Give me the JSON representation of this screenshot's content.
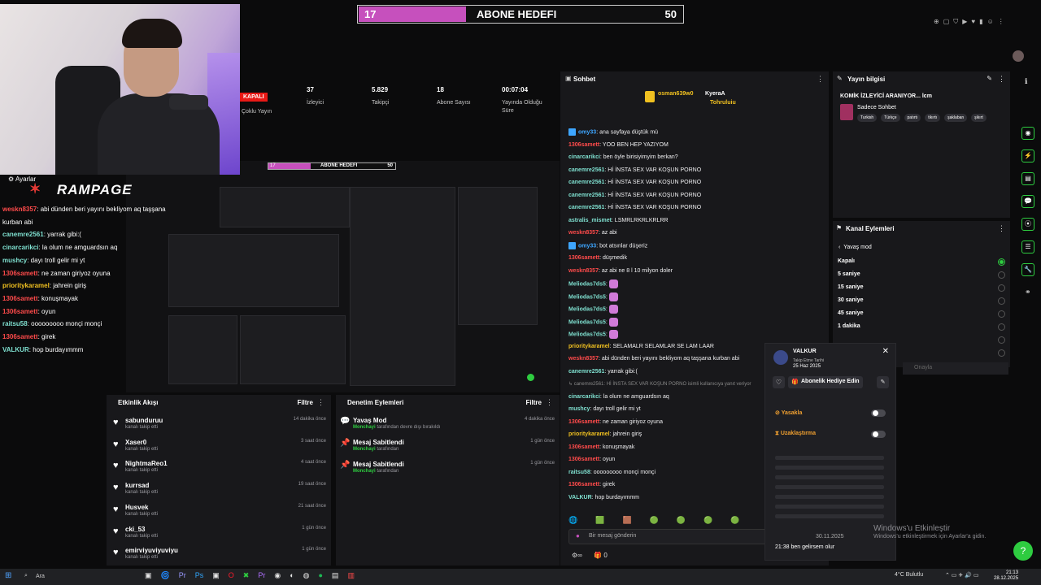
{
  "goal": {
    "current": "17",
    "title": "ABONE HEDEFI",
    "target": "50",
    "progress_fraction": 0.34
  },
  "overlay": {
    "settings_label": "Ayarlar",
    "logo": "RAMPAGE",
    "lines": [
      {
        "user": "weskn8357",
        "text": ": abi dünden beri yayını bekliyom aq taşşana",
        "color": "#ff4b4b"
      },
      {
        "user": "",
        "text": "kurban abi",
        "color": "#ffffff"
      },
      {
        "user": "canemre2561",
        "text": ": yarrak gibi:(",
        "color": "#7fe0d0"
      },
      {
        "user": "cinarcarikci",
        "text": ": la olum ne amguardsın aq",
        "color": "#7fe0d0"
      },
      {
        "user": "mushcy",
        "text": ": dayı troll gelir mi yt",
        "color": "#7fe0d0"
      },
      {
        "user": "1306samett",
        "text": ": ne zaman giriyoz oyuna",
        "color": "#ff4b4b"
      },
      {
        "user": "prioritykaramel",
        "text": ": jahrein giriş",
        "color": "#f0c020"
      },
      {
        "user": "1306samett",
        "text": ": konuşmayak",
        "color": "#ff4b4b"
      },
      {
        "user": "1306samett",
        "text": ": oyun",
        "color": "#ff4b4b"
      },
      {
        "user": "raitsu58",
        "text": ": ooooooooo monçi monçi",
        "color": "#7fe0d0"
      },
      {
        "user": "1306samett",
        "text": ": girek",
        "color": "#ff4b4b"
      },
      {
        "user": "VALKUR",
        "text": ": hop burdayımmm",
        "color": "#7fe0d0"
      }
    ]
  },
  "stats": {
    "live_badge": "KAPALI",
    "multi_label": "Çoklu Yayın",
    "items": [
      {
        "value": "37",
        "label": "İzleyici"
      },
      {
        "value": "5.829",
        "label": "Takipçi"
      },
      {
        "value": "18",
        "label": "Abone Sayısı"
      },
      {
        "value": "00:07:04",
        "label": "Yayında Olduğu Süre"
      }
    ]
  },
  "preview": {
    "goal_current": "17",
    "goal_title": "ABONE HEDEFI",
    "goal_target": "50"
  },
  "feed": {
    "title": "Etkinlik Akışı",
    "filter": "Filtre",
    "items": [
      {
        "name": "sabunduruu",
        "sub": "kanalı takip etti",
        "time": "14 dakika önce"
      },
      {
        "name": "Xaser0",
        "sub": "kanalı takip etti",
        "time": "3 saat önce"
      },
      {
        "name": "NightmaReo1",
        "sub": "kanalı takip etti",
        "time": "4 saat önce"
      },
      {
        "name": "kurrsad",
        "sub": "kanalı takip etti",
        "time": "19 saat önce"
      },
      {
        "name": "Husvek",
        "sub": "kanalı takip etti",
        "time": "21 saat önce"
      },
      {
        "name": "cki_53",
        "sub": "kanalı takip etti",
        "time": "1 gün önce"
      },
      {
        "name": "emirviyuviyuviyu",
        "sub": "kanalı takip etti",
        "time": "1 gün önce"
      }
    ]
  },
  "mod": {
    "title": "Denetim Eylemleri",
    "filter": "Filtre",
    "items": [
      {
        "icon": "💬",
        "name": "Yavaş Mod",
        "actor": "Monchayi",
        "sub": " tarafından devre dışı bırakıldı",
        "time": "4 dakika önce"
      },
      {
        "icon": "📌",
        "name": "Mesaj Sabitlendi",
        "actor": "Monchayi",
        "sub": " tarafından",
        "time": "1 gün önce"
      },
      {
        "icon": "📌",
        "name": "Mesaj Sabitlendi",
        "actor": "Monchayi",
        "sub": " tarafından",
        "time": "1 gün önce"
      }
    ]
  },
  "chat": {
    "title": "Sohbet",
    "top": [
      {
        "name": "osman639w0",
        "color": "#f0c020"
      },
      {
        "name": "KyeraA",
        "color": "#ffffff"
      },
      {
        "name": "Tohruluiu",
        "color": "#f0c020"
      }
    ],
    "messages": [
      {
        "user": "omy33",
        "text": ": ana sayfaya düştük mü",
        "color": "#3ea6ff",
        "badge": true
      },
      {
        "user": "1306samett",
        "text": ": YOO BEN HEP YAZIYOM",
        "color": "#ff4b4b"
      },
      {
        "user": "cinarcarikci",
        "text": ": ben öyle birisiyimyim berkan?",
        "color": "#7fe0d0"
      },
      {
        "user": "canemre2561",
        "text": ": Hİ İNSTA SEX VAR KOŞUN PORNO",
        "color": "#7fe0d0"
      },
      {
        "user": "canemre2561",
        "text": ": Hİ İNSTA SEX VAR KOŞUN PORNO",
        "color": "#7fe0d0"
      },
      {
        "user": "canemre2561",
        "text": ": Hİ İNSTA SEX VAR KOŞUN PORNO",
        "color": "#7fe0d0"
      },
      {
        "user": "canemre2561",
        "text": ": Hİ İNSTA SEX VAR KOŞUN PORNO",
        "color": "#7fe0d0"
      },
      {
        "user": "astralis_mismet",
        "text": ": LSMRLRKRLKRLRR",
        "color": "#7fe0d0"
      },
      {
        "user": "weskn8357",
        "text": ": az abi",
        "color": "#ff4b4b"
      },
      {
        "user": "omy33",
        "text": ": bot atsınlar düşeriz",
        "color": "#3ea6ff",
        "badge": true
      },
      {
        "user": "1306samett",
        "text": ": düşmedik",
        "color": "#ff4b4b"
      },
      {
        "user": "weskn8357",
        "text": ": az abi ne 8 l 10 milyon doler",
        "color": "#ff4b4b"
      },
      {
        "user": "Meliodas7ds5",
        "text": ":",
        "color": "#7fe0d0",
        "emote": true
      },
      {
        "user": "Meliodas7ds5",
        "text": ":",
        "color": "#7fe0d0",
        "emote": true
      },
      {
        "user": "Meliodas7ds5",
        "text": ":",
        "color": "#7fe0d0",
        "emote": true
      },
      {
        "user": "Meliodas7ds5",
        "text": ":",
        "color": "#7fe0d0",
        "emote": true
      },
      {
        "user": "Meliodas7ds5",
        "text": ":",
        "color": "#7fe0d0",
        "emote": true
      },
      {
        "user": "prioritykaramel",
        "text": ": SELAMALR SELAMLAR SE LAM LAAR",
        "color": "#f0c020"
      },
      {
        "user": "weskn8357",
        "text": ": abi dünden beri yayını bekliyom aq taşşana kurban abi",
        "color": "#ff4b4b"
      },
      {
        "user": "canemre2561",
        "text": ": yarrak gibi:(",
        "color": "#7fe0d0"
      },
      {
        "user": "",
        "text": "↳ canemre2561: Hİ İNSTA SEX VAR KOŞUN PORNO isimli kullanıcıya yanıt veriyor",
        "color": "#888888"
      },
      {
        "user": "cinarcarikci",
        "text": ": la olum ne amguardsın aq",
        "color": "#7fe0d0"
      },
      {
        "user": "mushcy",
        "text": ": dayı troll gelir mi yt",
        "color": "#7fe0d0"
      },
      {
        "user": "1306samett",
        "text": ": ne zaman giriyoz oyuna",
        "color": "#ff4b4b"
      },
      {
        "user": "prioritykaramel",
        "text": ": jahrein giriş",
        "color": "#f0c020"
      },
      {
        "user": "1306samett",
        "text": ": konuşmayak",
        "color": "#ff4b4b"
      },
      {
        "user": "1306samett",
        "text": ": oyun",
        "color": "#ff4b4b"
      },
      {
        "user": "raitsu58",
        "text": ": ooooooooo monçi monçi",
        "color": "#7fe0d0"
      },
      {
        "user": "1306samett",
        "text": ": girek",
        "color": "#ff4b4b"
      },
      {
        "user": "VALKUR",
        "text": ": hop burdayımmm",
        "color": "#7fe0d0"
      }
    ],
    "input_placeholder": "Bir mesaj gönderin",
    "bottom_count": "0"
  },
  "info": {
    "title": "Yayın bilgisi",
    "stream_title": "KOMİK İZLEYİCİ ARANIYOR... lcm",
    "category": "Sadece Sohbet",
    "tags": [
      "Turkish",
      "Türkçe",
      "patırtı",
      "tikırtı",
      "şaklaban",
      "şikırt"
    ]
  },
  "actions": {
    "title": "Kanal Eylemleri",
    "back": "Yavaş mod",
    "options": [
      "Kapalı",
      "5 saniye",
      "15 saniye",
      "30 saniye",
      "45 saniye",
      "1 dakika"
    ],
    "selected_index": 0,
    "confirm": "Onayla"
  },
  "card": {
    "name": "VALKUR",
    "since_label": "Takip Etme Tarihi",
    "since_date": "25 Haz 2025",
    "gift_label": "Abonelik Hediye Edin",
    "ban_label": "Yasakla",
    "timeout_label": "Uzaklaştırma",
    "date": "30.11.2025",
    "msg": "21:38 ben gelirsem olur"
  },
  "watermark": {
    "line1": "Windows'u Etkinleştir",
    "line2": "Windows'u etkinleştirmek için Ayarlar'a gidin."
  },
  "taskbar": {
    "search": "Ara",
    "weather": "4°C  Bulutlu",
    "time": "21:13",
    "date": "28.12.2025"
  }
}
